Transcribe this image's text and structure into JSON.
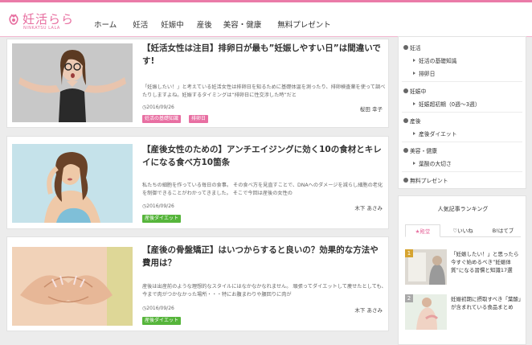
{
  "site": {
    "logo_text": "妊活らら",
    "logo_sub": "NINKATSU LALA"
  },
  "nav": [
    "ホーム",
    "妊活",
    "妊娠中",
    "産後",
    "美容・健康",
    "無料プレゼント"
  ],
  "articles": [
    {
      "title": "【妊活女性は注目】排卵日が最も”妊娠しやすい日”は間違いです!",
      "excerpt": "「妊娠したい！」と考えている妊活女性は排卵日を知るために基礎体温を測ったり、排卵検査薬を使って調べたりしますよね。妊娠するタイミングは“排卵日に性交渉した時”だと",
      "date": "2016/09/26",
      "author": "桜田 幸子",
      "tags": [
        "妊活の基礎知識",
        "排卵日"
      ]
    },
    {
      "title": "【産後女性のための】アンチエイジングに効く10の食材とキレイになる食べ方10箇条",
      "excerpt": "私たちの細胞を作っている毎日の食事。 その食べ方を見直すことで、DNAへのダメージを減らし細胞の老化を制御できることがわかってきました。 そこで今回は産後の女性の",
      "date": "2016/09/26",
      "author": "木下 あさみ",
      "tags": [
        "産後ダイエット"
      ]
    },
    {
      "title": "【産後の骨盤矯正】はいつからすると良いの？効果的な方法や費用は？",
      "excerpt": "産後は出産前のような理想的なスタイルにはなかなかなれません。 頑張ってダイエットして痩せたとしても、今まで肉がつかなかった場所・・・特にお腹まわりや腰回りに肉が",
      "date": "2016/09/26",
      "author": "木下 あさみ",
      "tags": [
        "産後ダイエット"
      ]
    }
  ],
  "sidebar": {
    "menu": [
      {
        "label": "妊活",
        "children": [
          "妊活の基礎知識",
          "排卵日"
        ]
      },
      {
        "label": "妊娠中",
        "children": [
          "妊娠超初期（0週〜3週）"
        ]
      },
      {
        "label": "産後",
        "children": [
          "産後ダイエット"
        ]
      },
      {
        "label": "美容・健康",
        "children": [
          "葉酸の大切さ"
        ]
      },
      {
        "label": "無料プレゼント",
        "children": []
      }
    ],
    "ranking": {
      "title": "人気記事ランキング",
      "tabs": [
        "★殿堂",
        "いいね",
        "B!はてブ"
      ],
      "items": [
        {
          "rank": "1",
          "text": "「妊娠したい！」と思ったら今すぐ始めるべき”妊娠体質”になる習慣と知識17選"
        },
        {
          "rank": "2",
          "text": "妊娠初期に摂取すべき「葉酸」が含まれている食品まとめ"
        }
      ]
    }
  },
  "colors": {
    "brand_pink": "#e76d9f",
    "tag_pink": "#e86fa2",
    "tag_green": "#56b53b"
  }
}
